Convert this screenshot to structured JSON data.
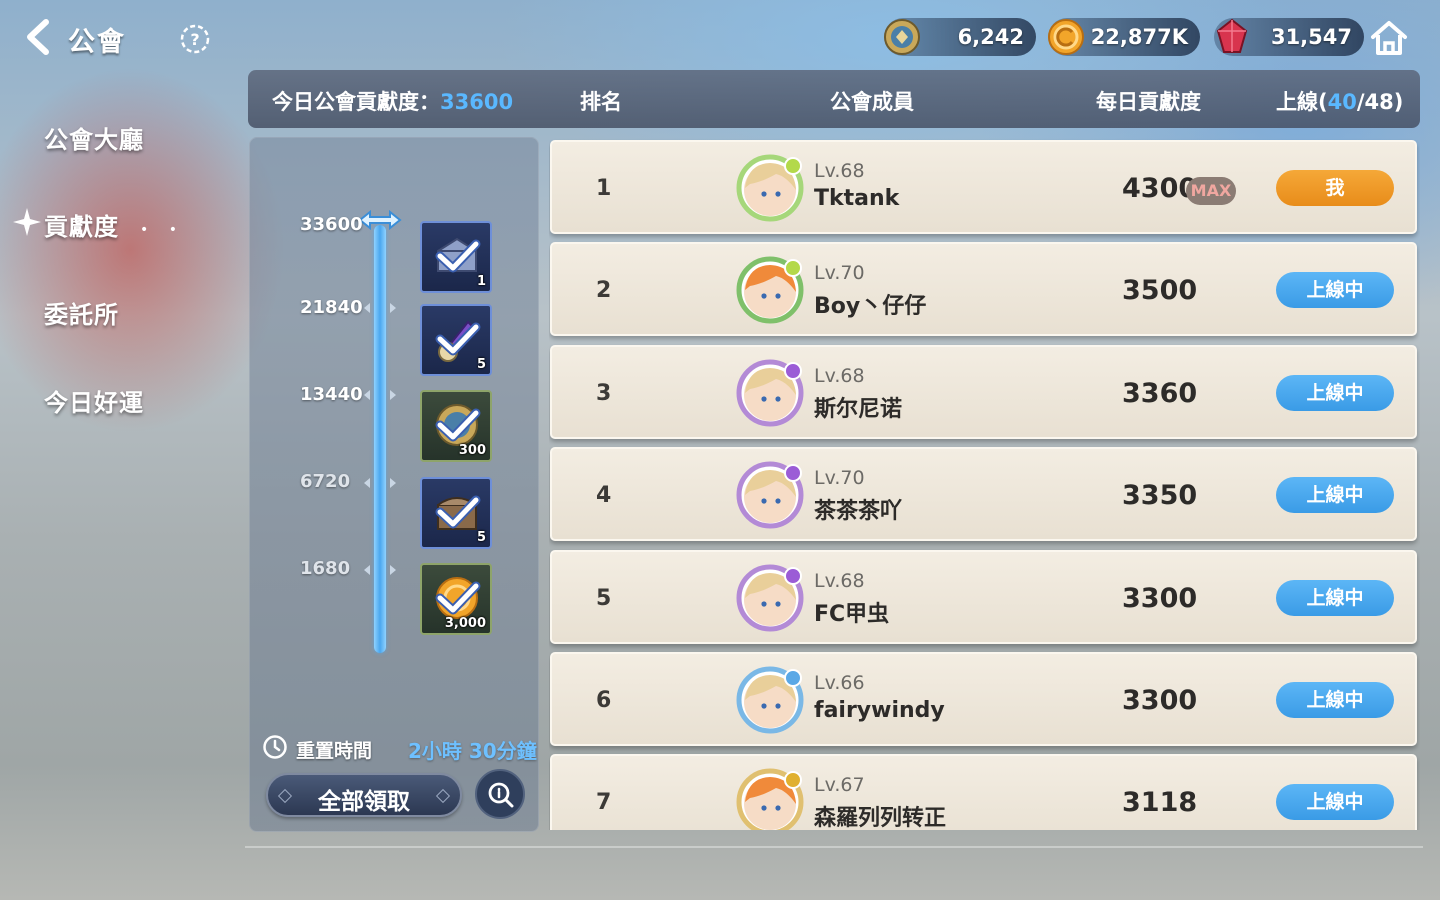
{
  "topbar": {
    "title": "公會",
    "currencies": [
      {
        "icon": "guild-token-icon",
        "value": "6,242"
      },
      {
        "icon": "gold-coin-icon",
        "value": "22,877K"
      },
      {
        "icon": "red-gem-icon",
        "value": "31,547"
      }
    ]
  },
  "nav": {
    "items": [
      {
        "label": "公會大廳",
        "active": false
      },
      {
        "label": "貢獻度",
        "active": true
      },
      {
        "label": "委託所",
        "active": false
      },
      {
        "label": "今日好運",
        "active": false
      }
    ]
  },
  "header": {
    "today_label": "今日公會貢獻度：",
    "today_value": "33600",
    "col_rank": "排名",
    "col_member": "公會成員",
    "col_daily": "每日貢獻度",
    "online_label": "上線(",
    "online_count": "40",
    "online_total": "/48)"
  },
  "rewards": {
    "progress_value": 33600,
    "milestones": [
      {
        "threshold": "33600",
        "count": "1",
        "item": "crystal-chest-icon",
        "claimed": true
      },
      {
        "threshold": "21840",
        "count": "5",
        "item": "purple-scroll-icon",
        "claimed": true
      },
      {
        "threshold": "13440",
        "count": "300",
        "item": "guild-token-icon",
        "claimed": true
      },
      {
        "threshold": "6720",
        "count": "5",
        "item": "treasure-chest-icon",
        "claimed": true
      },
      {
        "threshold": "1680",
        "count": "3,000",
        "item": "gold-coin-icon",
        "claimed": true
      }
    ],
    "reset_label": "重置時間",
    "reset_time": "2小時 30分鐘",
    "claim_all": "全部領取"
  },
  "members": [
    {
      "rank": "1",
      "level": "Lv.68",
      "name": "Tktank",
      "contribution": "4300",
      "max": "MAX",
      "status": "我",
      "status_type": "me",
      "frame_color": "#a6d77a",
      "hair": "#e9cf9a",
      "badge_color": "#b3d94a"
    },
    {
      "rank": "2",
      "level": "Lv.70",
      "name": "Boy丶仔仔",
      "contribution": "3500",
      "status": "上線中",
      "status_type": "online",
      "frame_color": "#7fc06a",
      "hair": "#f08a3a",
      "badge_color": "#b3d94a"
    },
    {
      "rank": "3",
      "level": "Lv.68",
      "name": "斯尔尼诺",
      "contribution": "3360",
      "status": "上線中",
      "status_type": "online",
      "frame_color": "#b38ad6",
      "hair": "#e9cf9a",
      "badge_color": "#9b5cd6"
    },
    {
      "rank": "4",
      "level": "Lv.70",
      "name": "茶茶茶吖",
      "contribution": "3350",
      "status": "上線中",
      "status_type": "online",
      "frame_color": "#b38ad6",
      "hair": "#e9cf9a",
      "badge_color": "#9b5cd6"
    },
    {
      "rank": "5",
      "level": "Lv.68",
      "name": "FC甲虫",
      "contribution": "3300",
      "status": "上線中",
      "status_type": "online",
      "frame_color": "#b38ad6",
      "hair": "#e9cf9a",
      "badge_color": "#9b5cd6"
    },
    {
      "rank": "6",
      "level": "Lv.66",
      "name": "fairywindy",
      "contribution": "3300",
      "status": "上線中",
      "status_type": "online",
      "frame_color": "#7ab8e6",
      "hair": "#e9cf9a",
      "badge_color": "#5aa8e6"
    },
    {
      "rank": "7",
      "level": "Lv.67",
      "name": "森羅列列转正",
      "contribution": "3118",
      "status": "上線中",
      "status_type": "online",
      "frame_color": "#e0c070",
      "hair": "#f08a3a",
      "badge_color": "#e0b030"
    }
  ]
}
